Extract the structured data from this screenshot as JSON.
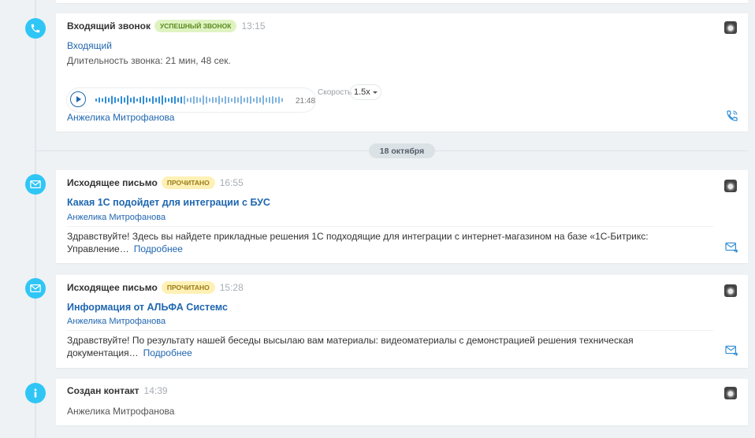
{
  "colors": {
    "accent": "#2fc6f6",
    "link": "#2067b0",
    "badge_success_bg": "#dff3c1",
    "badge_read_bg": "#fff1b6"
  },
  "events": [
    {
      "type": "call",
      "icon": "phone-icon",
      "title": "Входящий звонок",
      "badge": "Успешный звонок",
      "time": "13:15",
      "direction": "Входящий",
      "duration_text": "Длительность звонка: 21 мин, 48 сек.",
      "player": {
        "duration": "21:48",
        "speed_label": "Скорость",
        "speed_value": "1.5x"
      },
      "author": "Анжелика Митрофанова"
    },
    {
      "type": "email",
      "icon": "mail-icon",
      "title": "Исходящее письмо",
      "badge": "Прочитано",
      "time": "16:55",
      "subject": "Какая 1С подойдет для интеграции с БУС",
      "author": "Анжелика Митрофанова",
      "body": "Здравствуйте! Здесь вы найдете прикладные решения 1С подходящие для интеграции с интернет-магазином на базе «1С-Битрикс: Управление…",
      "more": "Подробнее"
    },
    {
      "type": "email",
      "icon": "mail-icon",
      "title": "Исходящее письмо",
      "badge": "Прочитано",
      "time": "15:28",
      "subject": "Информация от АЛЬФА Системс",
      "author": "Анжелика Митрофанова",
      "body": "Здравствуйте! По результату нашей беседы высылаю вам материалы: видеоматериалы с демонстрацией решения  техническая документация…",
      "more": "Подробнее"
    },
    {
      "type": "info",
      "icon": "info-icon",
      "title": "Создан контакт",
      "time": "14:39",
      "author": "Анжелика Митрофанова"
    }
  ],
  "date_separator": "18 октября"
}
